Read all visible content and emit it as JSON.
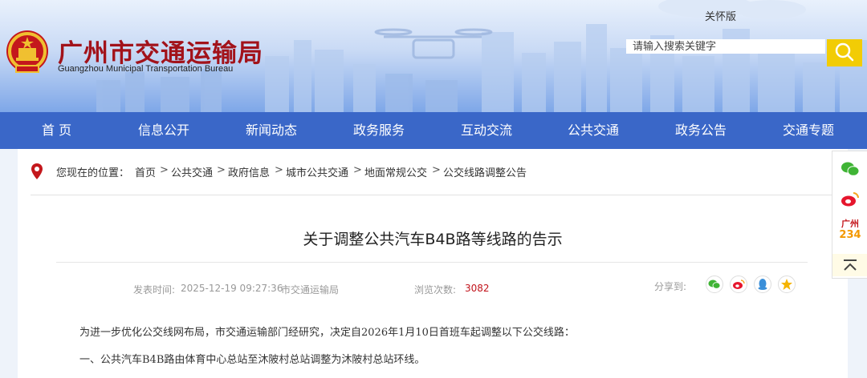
{
  "header": {
    "care_mode_link": "关怀版",
    "site_name": "广州市交通运输局",
    "site_name_en": "Guangzhou Municipal Transportation Bureau",
    "search": {
      "placeholder": "请输入搜索关键字"
    },
    "colors": {
      "brand_red": "#a2121a",
      "search_button": "#f2cc05",
      "nav_blue": "#3a67c8"
    }
  },
  "nav": {
    "items": [
      {
        "label": "首 页"
      },
      {
        "label": "信息公开"
      },
      {
        "label": "新闻动态"
      },
      {
        "label": "政务服务"
      },
      {
        "label": "互动交流"
      },
      {
        "label": "公共交通"
      },
      {
        "label": "政务公告"
      },
      {
        "label": "交通专题"
      }
    ]
  },
  "breadcrumb": {
    "prefix": "您现在的位置：",
    "items": [
      "首页",
      "公共交通",
      "政府信息",
      "城市公共交通",
      "地面常规公交",
      "公交线路调整公告"
    ],
    "separator": ">"
  },
  "article": {
    "title": "关于调整公共汽车B4B路等线路的告示",
    "publish_label": "发表时间:",
    "publish_time": "2025-12-19 09:27:36",
    "source": "市交通运输局",
    "views_label": "浏览次数:",
    "views": "3082",
    "share_label": "分享到:",
    "share_icons": [
      "wechat-icon",
      "weibo-icon",
      "qq-icon",
      "qzone-icon"
    ],
    "paragraphs": [
      "为进一步优化公交线网布局，市交通运输部门经研究，决定自2026年1月10日首班车起调整以下公交线路：",
      "一、公共汽车B4B路由体育中心总站至沐陂村总站调整为沐陂村总站环线。"
    ]
  },
  "sidebar_float": {
    "badge_line1": "广州",
    "badge_line2": "234",
    "icons": [
      "wechat-icon",
      "weibo-icon",
      "gz234-icon",
      "back-to-top-icon"
    ]
  }
}
